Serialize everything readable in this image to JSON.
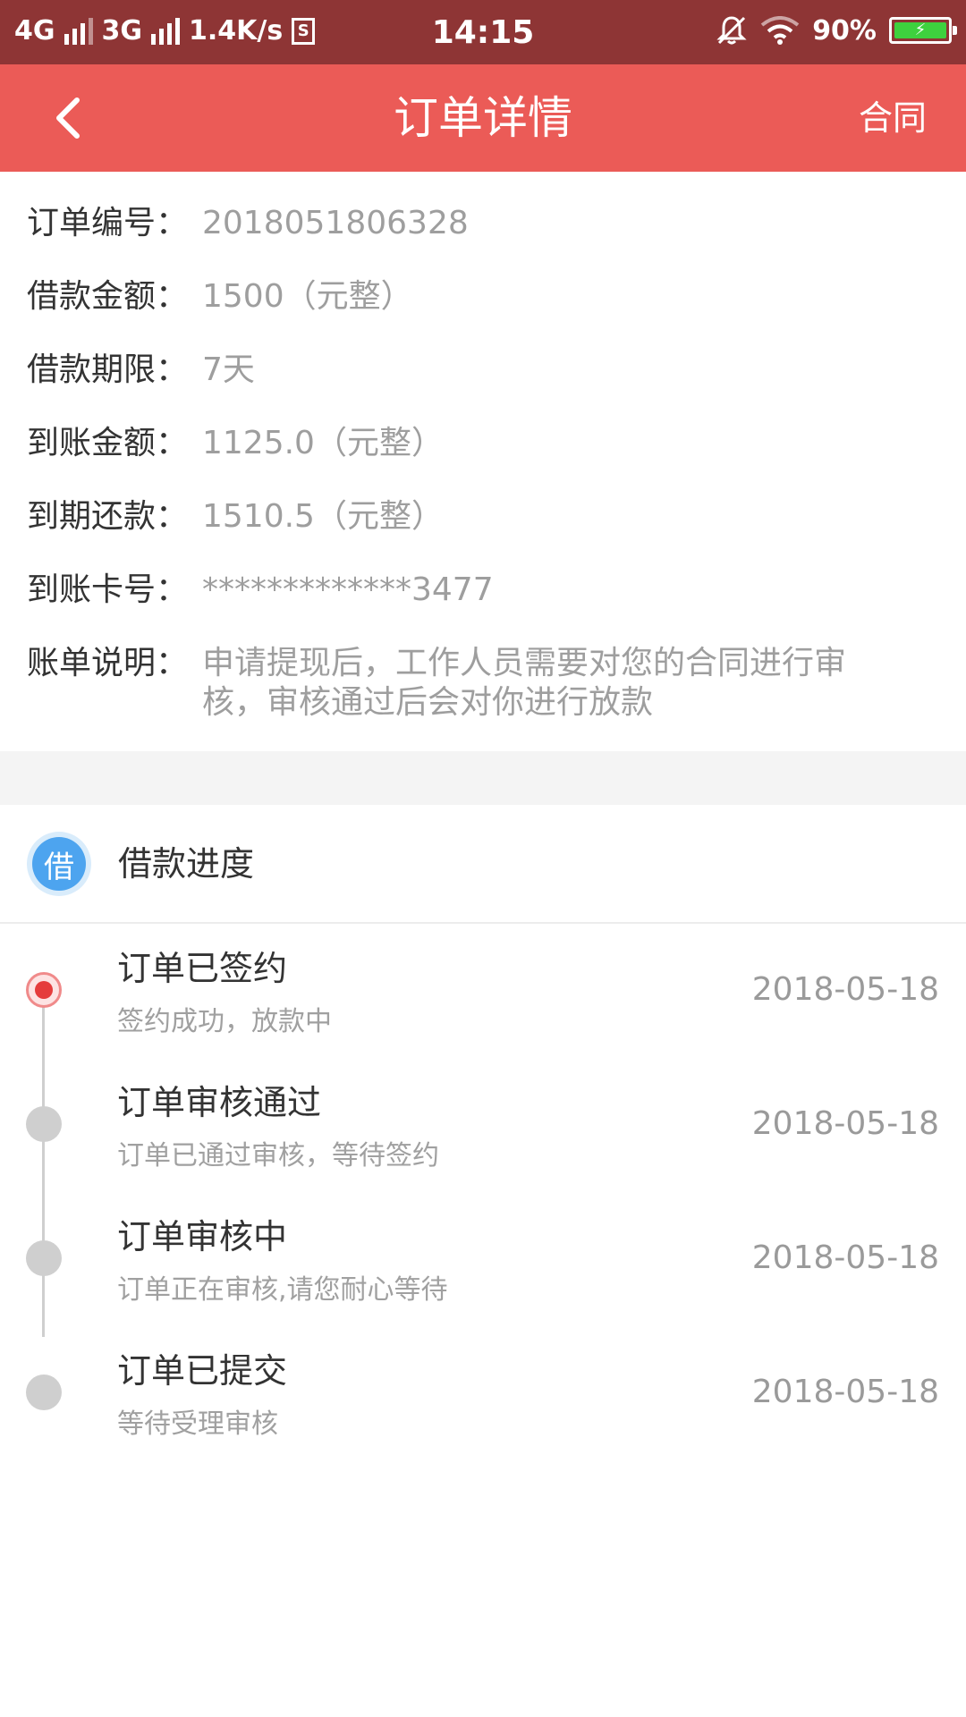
{
  "status_bar": {
    "network1": "4G",
    "network2": "3G",
    "speed": "1.4K/s",
    "sim_label": "S",
    "time": "14:15",
    "battery": "90%",
    "icons": [
      "signal-icon",
      "mute-icon",
      "wifi-icon",
      "battery-icon"
    ]
  },
  "nav": {
    "title": "订单详情",
    "right_label": "合同",
    "background": "#eb5b57"
  },
  "order": {
    "rows": [
      {
        "label": "订单编号：",
        "value": "2018051806328"
      },
      {
        "label": "借款金额：",
        "value": "1500（元整）"
      },
      {
        "label": "借款期限：",
        "value": "7天"
      },
      {
        "label": "到账金额：",
        "value": "1125.0（元整）"
      },
      {
        "label": "到期还款：",
        "value": "1510.5（元整）"
      },
      {
        "label": "到账卡号：",
        "value": "*************3477"
      },
      {
        "label": "账单说明：",
        "value": "申请提现后，工作人员需要对您的合同进行审核，审核通过后会对你进行放款"
      }
    ]
  },
  "progress": {
    "badge": "借",
    "heading": "借款进度",
    "steps": [
      {
        "title": "订单已签约",
        "subtitle": "签约成功，放款中",
        "date": "2018-05-18",
        "active": true
      },
      {
        "title": "订单审核通过",
        "subtitle": "订单已通过审核，等待签约",
        "date": "2018-05-18",
        "active": false
      },
      {
        "title": "订单审核中",
        "subtitle": "订单正在审核,请您耐心等待",
        "date": "2018-05-18",
        "active": false
      },
      {
        "title": "订单已提交",
        "subtitle": "等待受理审核",
        "date": "2018-05-18",
        "active": false
      }
    ]
  },
  "colors": {
    "status_bar": "#8e3535",
    "accent": "#eb5b57",
    "badge": "#4da4ef"
  }
}
